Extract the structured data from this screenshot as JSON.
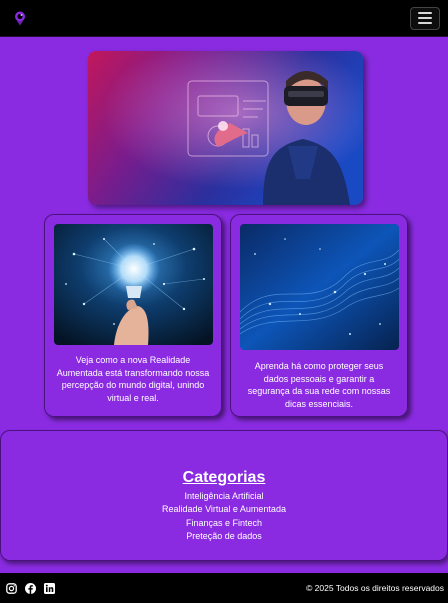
{
  "nav": {
    "logo_icon": "brand-logo-icon",
    "menu_icon": "hamburger-menu-icon"
  },
  "hero": {
    "image": "person-wearing-vr-headset-touching-holographic-interface"
  },
  "cards": [
    {
      "image": "glowing-lightbulb-held-in-hand-with-network-particles",
      "text": "Veja como a nova Realidade Aumentada está transformando nossa percepção do mundo digital, unindo virtual e real."
    },
    {
      "image": "blue-digital-wave-of-particles",
      "text": "Aprenda há como proteger seus dados pessoais e garantir a segurança da sua rede com nossas dicas essenciais."
    }
  ],
  "categories": {
    "title": "Categorias",
    "items": [
      "Inteligência Artificial",
      "Realidade Virtual e Aumentada",
      "Finanças e Fintech",
      "Preteção de dados"
    ]
  },
  "footer": {
    "social_icons": [
      "instagram-icon",
      "facebook-icon",
      "linkedin-icon"
    ],
    "copyright": "© 2025 Todos os direitos reservados"
  },
  "colors": {
    "page_bg": "#8a2be2",
    "bar_bg": "#000000",
    "border": "#4b127f",
    "text": "#ffffff"
  }
}
